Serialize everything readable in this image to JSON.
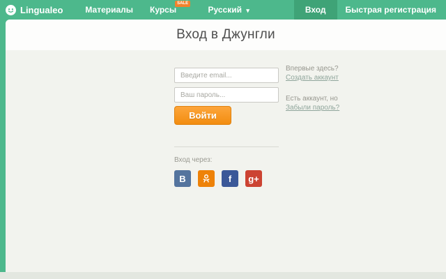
{
  "header": {
    "brand": "Lingualeo",
    "nav": [
      {
        "label": "Материалы"
      },
      {
        "label": "Курсы",
        "badge": "SALE"
      }
    ],
    "language": {
      "label": "Русский",
      "caret_glyph": "▾"
    },
    "login_tab": "Вход",
    "register_label": "Быстрая регистрация"
  },
  "main": {
    "title": "Вход в Джунгли",
    "form": {
      "email_placeholder": "Введите email...",
      "password_placeholder": "Ваш пароль...",
      "submit_label": "Войти"
    },
    "aside": {
      "first_time": "Впервые здесь?",
      "create_account_link": "Создать аккаунт",
      "have_account": "Есть аккаунт, но",
      "forgot_password_link": "Забыли пароль?"
    },
    "social": {
      "label": "Вход через:",
      "buttons": [
        {
          "name": "vk",
          "glyph": "В",
          "color": "#54749e"
        },
        {
          "name": "odnoklassniki",
          "glyph": "",
          "color": "#ee8208"
        },
        {
          "name": "facebook",
          "glyph": "f",
          "color": "#3b5898"
        },
        {
          "name": "googleplus",
          "glyph": "g+",
          "color": "#cc4332"
        }
      ]
    }
  },
  "colors": {
    "header_green": "#4db88c",
    "active_tab_green": "#3fa377",
    "badge_orange": "#f2822c",
    "button_orange": "#f28d10",
    "card_bg": "#f2f3ee"
  }
}
